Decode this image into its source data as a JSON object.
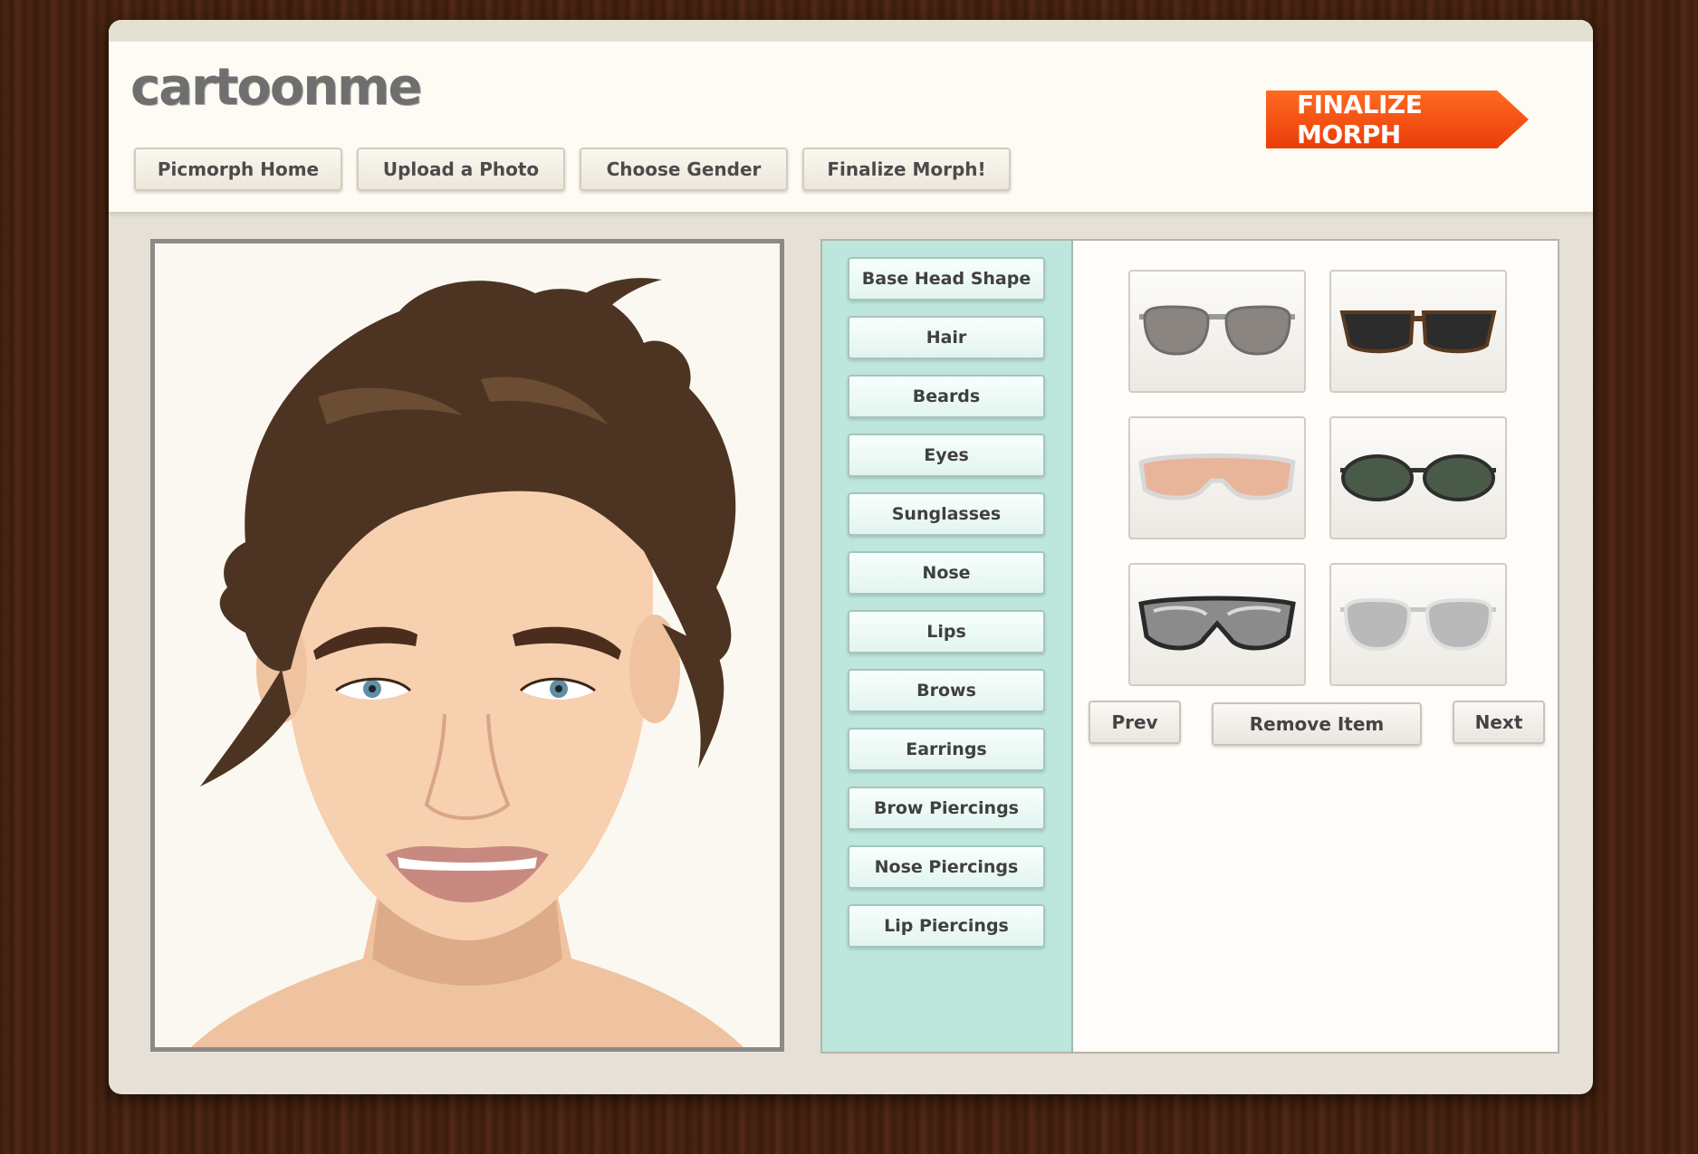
{
  "brand": {
    "logo_text": "cartoonme"
  },
  "nav": {
    "items": [
      {
        "label": "Picmorph Home"
      },
      {
        "label": "Upload a Photo"
      },
      {
        "label": "Choose Gender"
      },
      {
        "label": "Finalize Morph!"
      }
    ]
  },
  "finalize_button": {
    "label": "FINALIZE MORPH"
  },
  "categories": [
    {
      "label": "Base Head Shape"
    },
    {
      "label": "Hair"
    },
    {
      "label": "Beards"
    },
    {
      "label": "Eyes"
    },
    {
      "label": "Sunglasses"
    },
    {
      "label": "Nose"
    },
    {
      "label": "Lips"
    },
    {
      "label": "Brows"
    },
    {
      "label": "Earrings"
    },
    {
      "label": "Brow Piercings"
    },
    {
      "label": "Nose Piercings"
    },
    {
      "label": "Lip Piercings"
    }
  ],
  "items": [
    {
      "icon": "aviator-sunglasses-gray-icon"
    },
    {
      "icon": "wayfarer-sunglasses-tortoise-icon"
    },
    {
      "icon": "sport-sunglasses-pink-icon"
    },
    {
      "icon": "round-sunglasses-green-icon"
    },
    {
      "icon": "shield-sunglasses-chrome-icon"
    },
    {
      "icon": "aviator-sunglasses-silver-icon"
    }
  ],
  "controls": {
    "prev_label": "Prev",
    "remove_label": "Remove Item",
    "next_label": "Next"
  },
  "colors": {
    "accent_orange": "#f04d10",
    "category_bg": "#bde6dc",
    "panel_bg": "#e6e1d6"
  }
}
